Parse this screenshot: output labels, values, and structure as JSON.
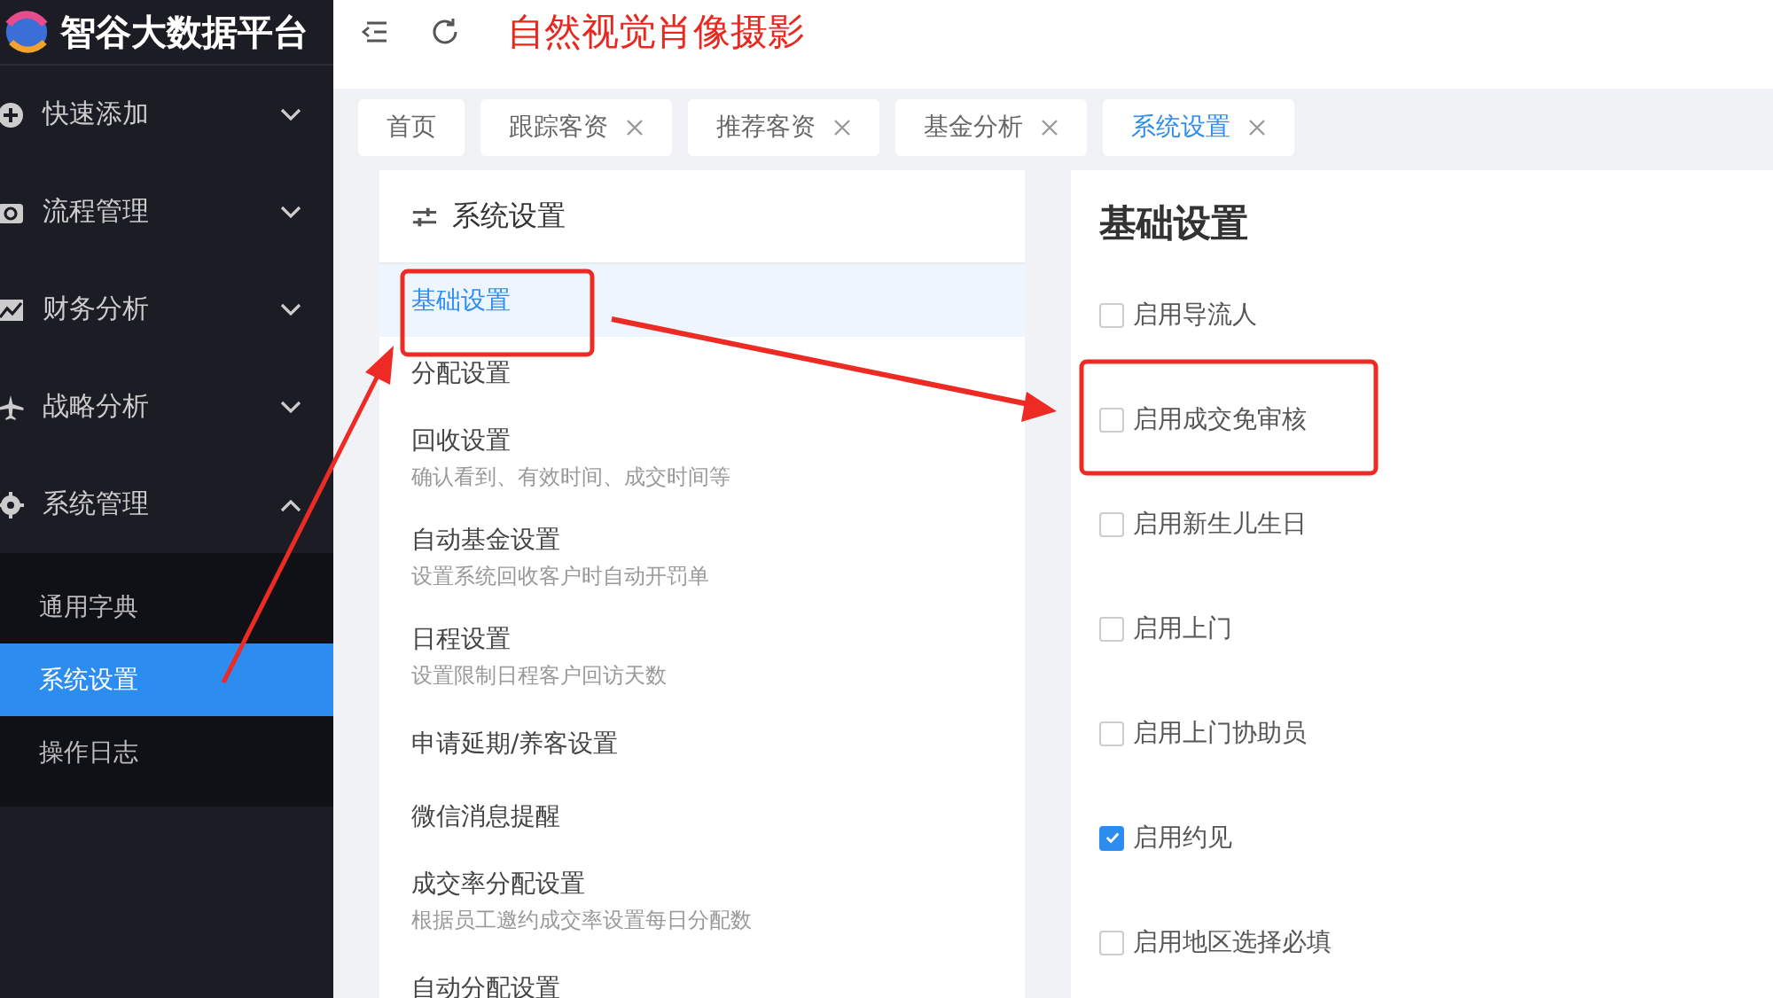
{
  "sidebar": {
    "logo_text": "智谷大数据平台",
    "menu": [
      {
        "label": "快速添加",
        "expanded": false
      },
      {
        "label": "流程管理",
        "expanded": false
      },
      {
        "label": "财务分析",
        "expanded": false
      },
      {
        "label": "战略分析",
        "expanded": false
      },
      {
        "label": "系统管理",
        "expanded": true,
        "children": [
          {
            "label": "通用字典",
            "selected": false
          },
          {
            "label": "系统设置",
            "selected": true
          },
          {
            "label": "操作日志",
            "selected": false
          }
        ]
      }
    ]
  },
  "header": {
    "title": "自然视觉肖像摄影"
  },
  "tabs": [
    {
      "label": "首页",
      "closable": false,
      "selected": false
    },
    {
      "label": "跟踪客资",
      "closable": true,
      "selected": false
    },
    {
      "label": "推荐客资",
      "closable": true,
      "selected": false
    },
    {
      "label": "基金分析",
      "closable": true,
      "selected": false
    },
    {
      "label": "系统设置",
      "closable": true,
      "selected": true
    }
  ],
  "settings_nav": {
    "title": "系统设置",
    "items": [
      {
        "label": "基础设置",
        "selected": true
      },
      {
        "label": "分配设置",
        "selected": false
      },
      {
        "label": "回收设置",
        "description": "确认看到、有效时间、成交时间等",
        "selected": false
      },
      {
        "label": "自动基金设置",
        "description": "设置系统回收客户时自动开罚单",
        "selected": false
      },
      {
        "label": "日程设置",
        "description": "设置限制日程客户回访天数",
        "selected": false
      },
      {
        "label": "申请延期/养客设置",
        "selected": false
      },
      {
        "label": "微信消息提醒",
        "selected": false
      },
      {
        "label": "成交率分配设置",
        "description": "根据员工邀约成交率设置每日分配数",
        "selected": false
      },
      {
        "label": "自动分配设置",
        "selected": false
      }
    ]
  },
  "basic_settings": {
    "title": "基础设置",
    "options": [
      {
        "label": "启用导流人",
        "checked": false
      },
      {
        "label": "启用成交免审核",
        "checked": false
      },
      {
        "label": "启用新生儿生日",
        "checked": false
      },
      {
        "label": "启用上门",
        "checked": false
      },
      {
        "label": "启用上门协助员",
        "checked": false
      },
      {
        "label": "启用约见",
        "checked": true
      },
      {
        "label": "启用地区选择必填",
        "checked": false
      }
    ]
  }
}
